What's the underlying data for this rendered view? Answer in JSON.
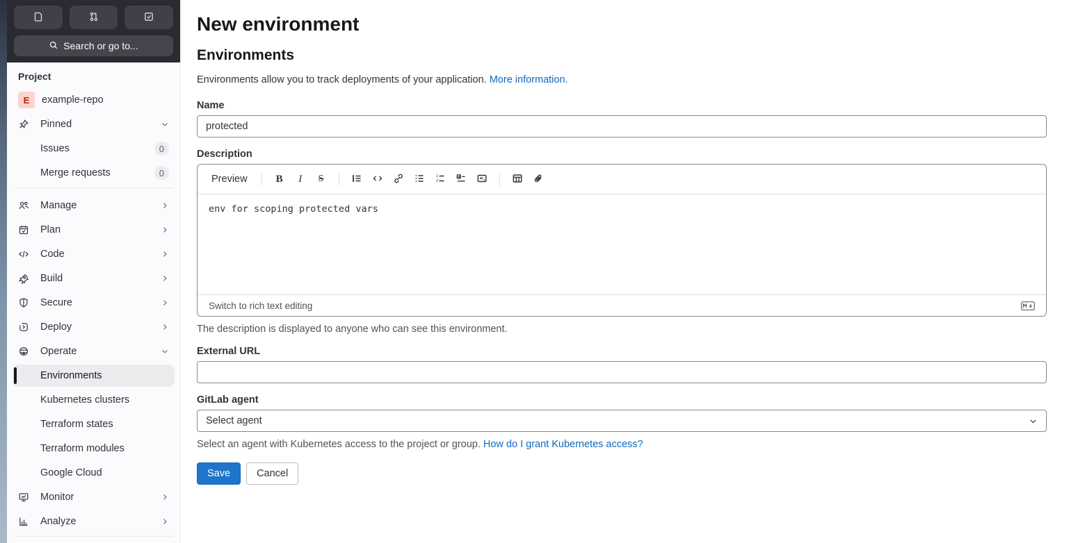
{
  "topbar": {
    "search_placeholder": "Search or go to..."
  },
  "sidebar": {
    "section_label": "Project",
    "project": {
      "avatar_letter": "E",
      "name": "example-repo"
    },
    "pinned": {
      "label": "Pinned",
      "items": [
        {
          "label": "Issues",
          "count": "0"
        },
        {
          "label": "Merge requests",
          "count": "0"
        }
      ]
    },
    "menu": [
      {
        "label": "Manage"
      },
      {
        "label": "Plan"
      },
      {
        "label": "Code"
      },
      {
        "label": "Build"
      },
      {
        "label": "Secure"
      },
      {
        "label": "Deploy"
      },
      {
        "label": "Operate"
      }
    ],
    "operate_children": [
      {
        "label": "Environments",
        "active": true
      },
      {
        "label": "Kubernetes clusters"
      },
      {
        "label": "Terraform states"
      },
      {
        "label": "Terraform modules"
      },
      {
        "label": "Google Cloud"
      }
    ],
    "bottom_menu": [
      {
        "label": "Monitor"
      },
      {
        "label": "Analyze"
      }
    ]
  },
  "main": {
    "title": "New environment",
    "section_heading": "Environments",
    "intro_text": "Environments allow you to track deployments of your application. ",
    "intro_link": "More information.",
    "name_field": {
      "label": "Name",
      "value": "protected"
    },
    "description_field": {
      "label": "Description",
      "preview_label": "Preview",
      "value": "env for scoping protected vars",
      "switch_label": "Switch to rich text editing",
      "helper": "The description is displayed to anyone who can see this environment."
    },
    "external_url_field": {
      "label": "External URL",
      "value": ""
    },
    "agent_field": {
      "label": "GitLab agent",
      "selected": "Select agent",
      "helper": "Select an agent with Kubernetes access to the project or group. ",
      "helper_link": "How do I grant Kubernetes access?"
    },
    "save_label": "Save",
    "cancel_label": "Cancel"
  },
  "colors": {
    "accent_blue": "#1f75cb",
    "link_blue": "#1068bf",
    "sidebar_dark": "#2b2a31",
    "active_item_bg": "#ececef"
  }
}
